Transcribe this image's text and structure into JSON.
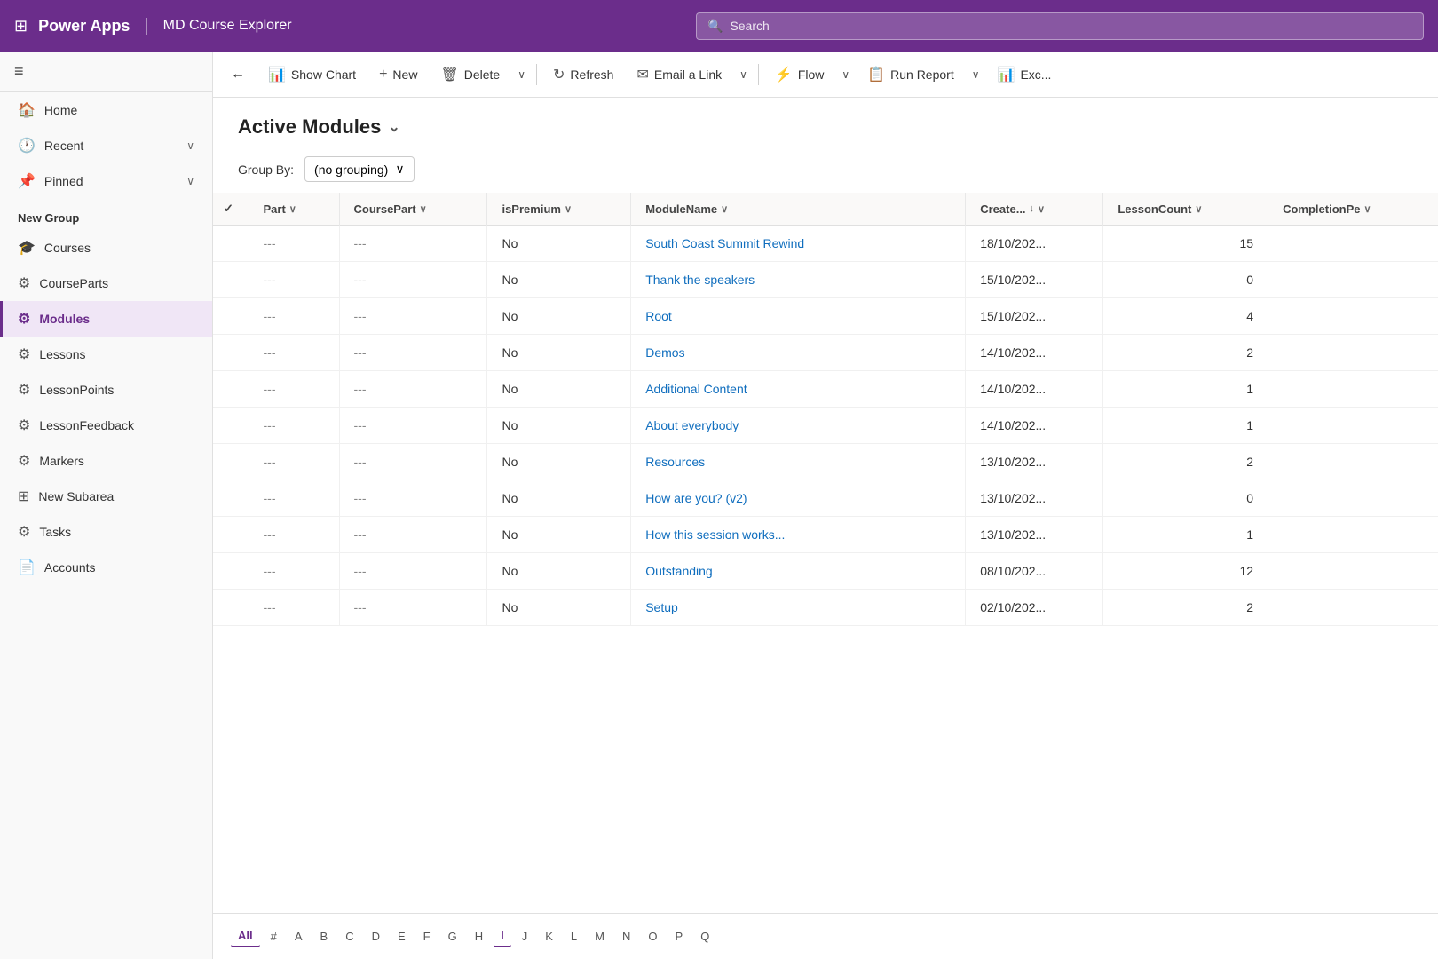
{
  "topnav": {
    "app_name": "Power Apps",
    "page_title": "MD Course Explorer",
    "search_placeholder": "Search"
  },
  "sidebar": {
    "hamburger_label": "≡",
    "items": [
      {
        "id": "home",
        "label": "Home",
        "icon": "⌂"
      },
      {
        "id": "recent",
        "label": "Recent",
        "icon": "🕐",
        "chevron": "∨"
      },
      {
        "id": "pinned",
        "label": "Pinned",
        "icon": "📌",
        "chevron": "∨"
      }
    ],
    "group_label": "New Group",
    "group_items": [
      {
        "id": "courses",
        "label": "Courses",
        "icon": "🎓"
      },
      {
        "id": "courseparts",
        "label": "CourseParts",
        "icon": "⚙"
      },
      {
        "id": "modules",
        "label": "Modules",
        "icon": "⚙",
        "active": true
      },
      {
        "id": "lessons",
        "label": "Lessons",
        "icon": "⚙"
      },
      {
        "id": "lessonpoints",
        "label": "LessonPoints",
        "icon": "⚙"
      },
      {
        "id": "lessonfeedback",
        "label": "LessonFeedback",
        "icon": "⚙"
      },
      {
        "id": "markers",
        "label": "Markers",
        "icon": "⚙"
      },
      {
        "id": "newsubarea",
        "label": "New Subarea",
        "icon": "⊞"
      },
      {
        "id": "tasks",
        "label": "Tasks",
        "icon": "⚙"
      },
      {
        "id": "accounts",
        "label": "Accounts",
        "icon": "📄"
      }
    ]
  },
  "toolbar": {
    "back_label": "←",
    "show_chart_label": "Show Chart",
    "new_label": "New",
    "delete_label": "Delete",
    "refresh_label": "Refresh",
    "email_link_label": "Email a Link",
    "flow_label": "Flow",
    "run_report_label": "Run Report",
    "excel_label": "Exc..."
  },
  "page_header": {
    "title": "Active Modules",
    "chevron": "⌄"
  },
  "group_by": {
    "label": "Group By:",
    "value": "(no grouping)",
    "chevron": "∨"
  },
  "table": {
    "columns": [
      {
        "id": "check",
        "label": "✓"
      },
      {
        "id": "part",
        "label": "Part",
        "sortable": true
      },
      {
        "id": "coursepart",
        "label": "CoursePart",
        "sortable": true
      },
      {
        "id": "ispremium",
        "label": "isPremium",
        "sortable": true
      },
      {
        "id": "modulename",
        "label": "ModuleName",
        "sortable": true
      },
      {
        "id": "created",
        "label": "Create...",
        "sortable": true,
        "sorted": "desc"
      },
      {
        "id": "lessoncount",
        "label": "LessonCount",
        "sortable": true
      },
      {
        "id": "completionpe",
        "label": "CompletionPe",
        "sortable": true
      }
    ],
    "rows": [
      {
        "part": "---",
        "coursepart": "---",
        "ispremium": "No",
        "modulename": "South Coast Summit Rewind",
        "created": "18/10/202...",
        "lessoncount": "15",
        "completionpe": ""
      },
      {
        "part": "---",
        "coursepart": "---",
        "ispremium": "No",
        "modulename": "Thank the speakers",
        "created": "15/10/202...",
        "lessoncount": "0",
        "completionpe": ""
      },
      {
        "part": "---",
        "coursepart": "---",
        "ispremium": "No",
        "modulename": "Root",
        "created": "15/10/202...",
        "lessoncount": "4",
        "completionpe": ""
      },
      {
        "part": "---",
        "coursepart": "---",
        "ispremium": "No",
        "modulename": "Demos",
        "created": "14/10/202...",
        "lessoncount": "2",
        "completionpe": ""
      },
      {
        "part": "---",
        "coursepart": "---",
        "ispremium": "No",
        "modulename": "Additional Content",
        "created": "14/10/202...",
        "lessoncount": "1",
        "completionpe": ""
      },
      {
        "part": "---",
        "coursepart": "---",
        "ispremium": "No",
        "modulename": "About everybody",
        "created": "14/10/202...",
        "lessoncount": "1",
        "completionpe": ""
      },
      {
        "part": "---",
        "coursepart": "---",
        "ispremium": "No",
        "modulename": "Resources",
        "created": "13/10/202...",
        "lessoncount": "2",
        "completionpe": ""
      },
      {
        "part": "---",
        "coursepart": "---",
        "ispremium": "No",
        "modulename": "How are you? (v2)",
        "created": "13/10/202...",
        "lessoncount": "0",
        "completionpe": ""
      },
      {
        "part": "---",
        "coursepart": "---",
        "ispremium": "No",
        "modulename": "How this session works...",
        "created": "13/10/202...",
        "lessoncount": "1",
        "completionpe": ""
      },
      {
        "part": "---",
        "coursepart": "---",
        "ispremium": "No",
        "modulename": "Outstanding",
        "created": "08/10/202...",
        "lessoncount": "12",
        "completionpe": ""
      },
      {
        "part": "---",
        "coursepart": "---",
        "ispremium": "No",
        "modulename": "Setup",
        "created": "02/10/202...",
        "lessoncount": "2",
        "completionpe": ""
      }
    ]
  },
  "pagination": {
    "letters": [
      "All",
      "#",
      "A",
      "B",
      "C",
      "D",
      "E",
      "F",
      "G",
      "H",
      "I",
      "J",
      "K",
      "L",
      "M",
      "N",
      "O",
      "P",
      "Q"
    ]
  },
  "colors": {
    "brand": "#6b2d8b",
    "header_bg": "#6b2d8b"
  }
}
